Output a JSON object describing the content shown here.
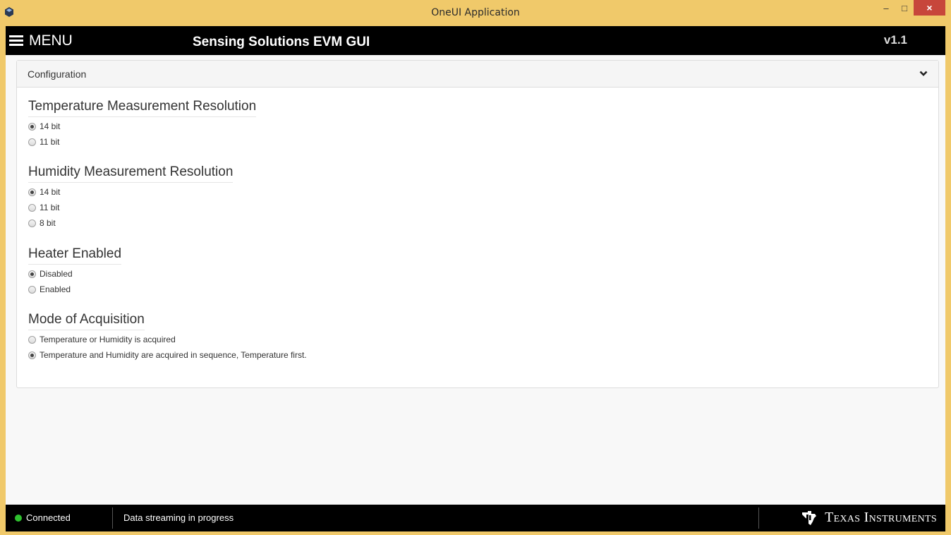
{
  "window": {
    "title": "OneUI Application",
    "minimize": "–",
    "maximize": "□",
    "close": "×"
  },
  "header": {
    "menu_label": "MENU",
    "app_title": "Sensing Solutions EVM GUI",
    "version": "v1.1"
  },
  "panel": {
    "title": "Configuration"
  },
  "groups": {
    "temperature": {
      "title": "Temperature Measurement Resolution",
      "options": [
        "14 bit",
        "11 bit"
      ],
      "selected": "14 bit"
    },
    "humidity": {
      "title": "Humidity Measurement Resolution",
      "options": [
        "14 bit",
        "11 bit",
        "8 bit"
      ],
      "selected": "14 bit"
    },
    "heater": {
      "title": "Heater Enabled",
      "options": [
        "Disabled",
        "Enabled"
      ],
      "selected": "Disabled"
    },
    "mode": {
      "title": "Mode of Acquisition",
      "options": [
        "Temperature or Humidity is acquired",
        "Temperature and Humidity are acquired in sequence, Temperature first."
      ],
      "selected": "Temperature and Humidity are acquired in sequence, Temperature first."
    }
  },
  "status": {
    "connection": "Connected",
    "message": "Data streaming in progress",
    "connection_color": "#2fc12f"
  },
  "brand": {
    "logo_text": "Texas Instruments"
  },
  "colors": {
    "frame": "#f0c96a",
    "header_bg": "#000000",
    "close_button": "#c7463b"
  }
}
